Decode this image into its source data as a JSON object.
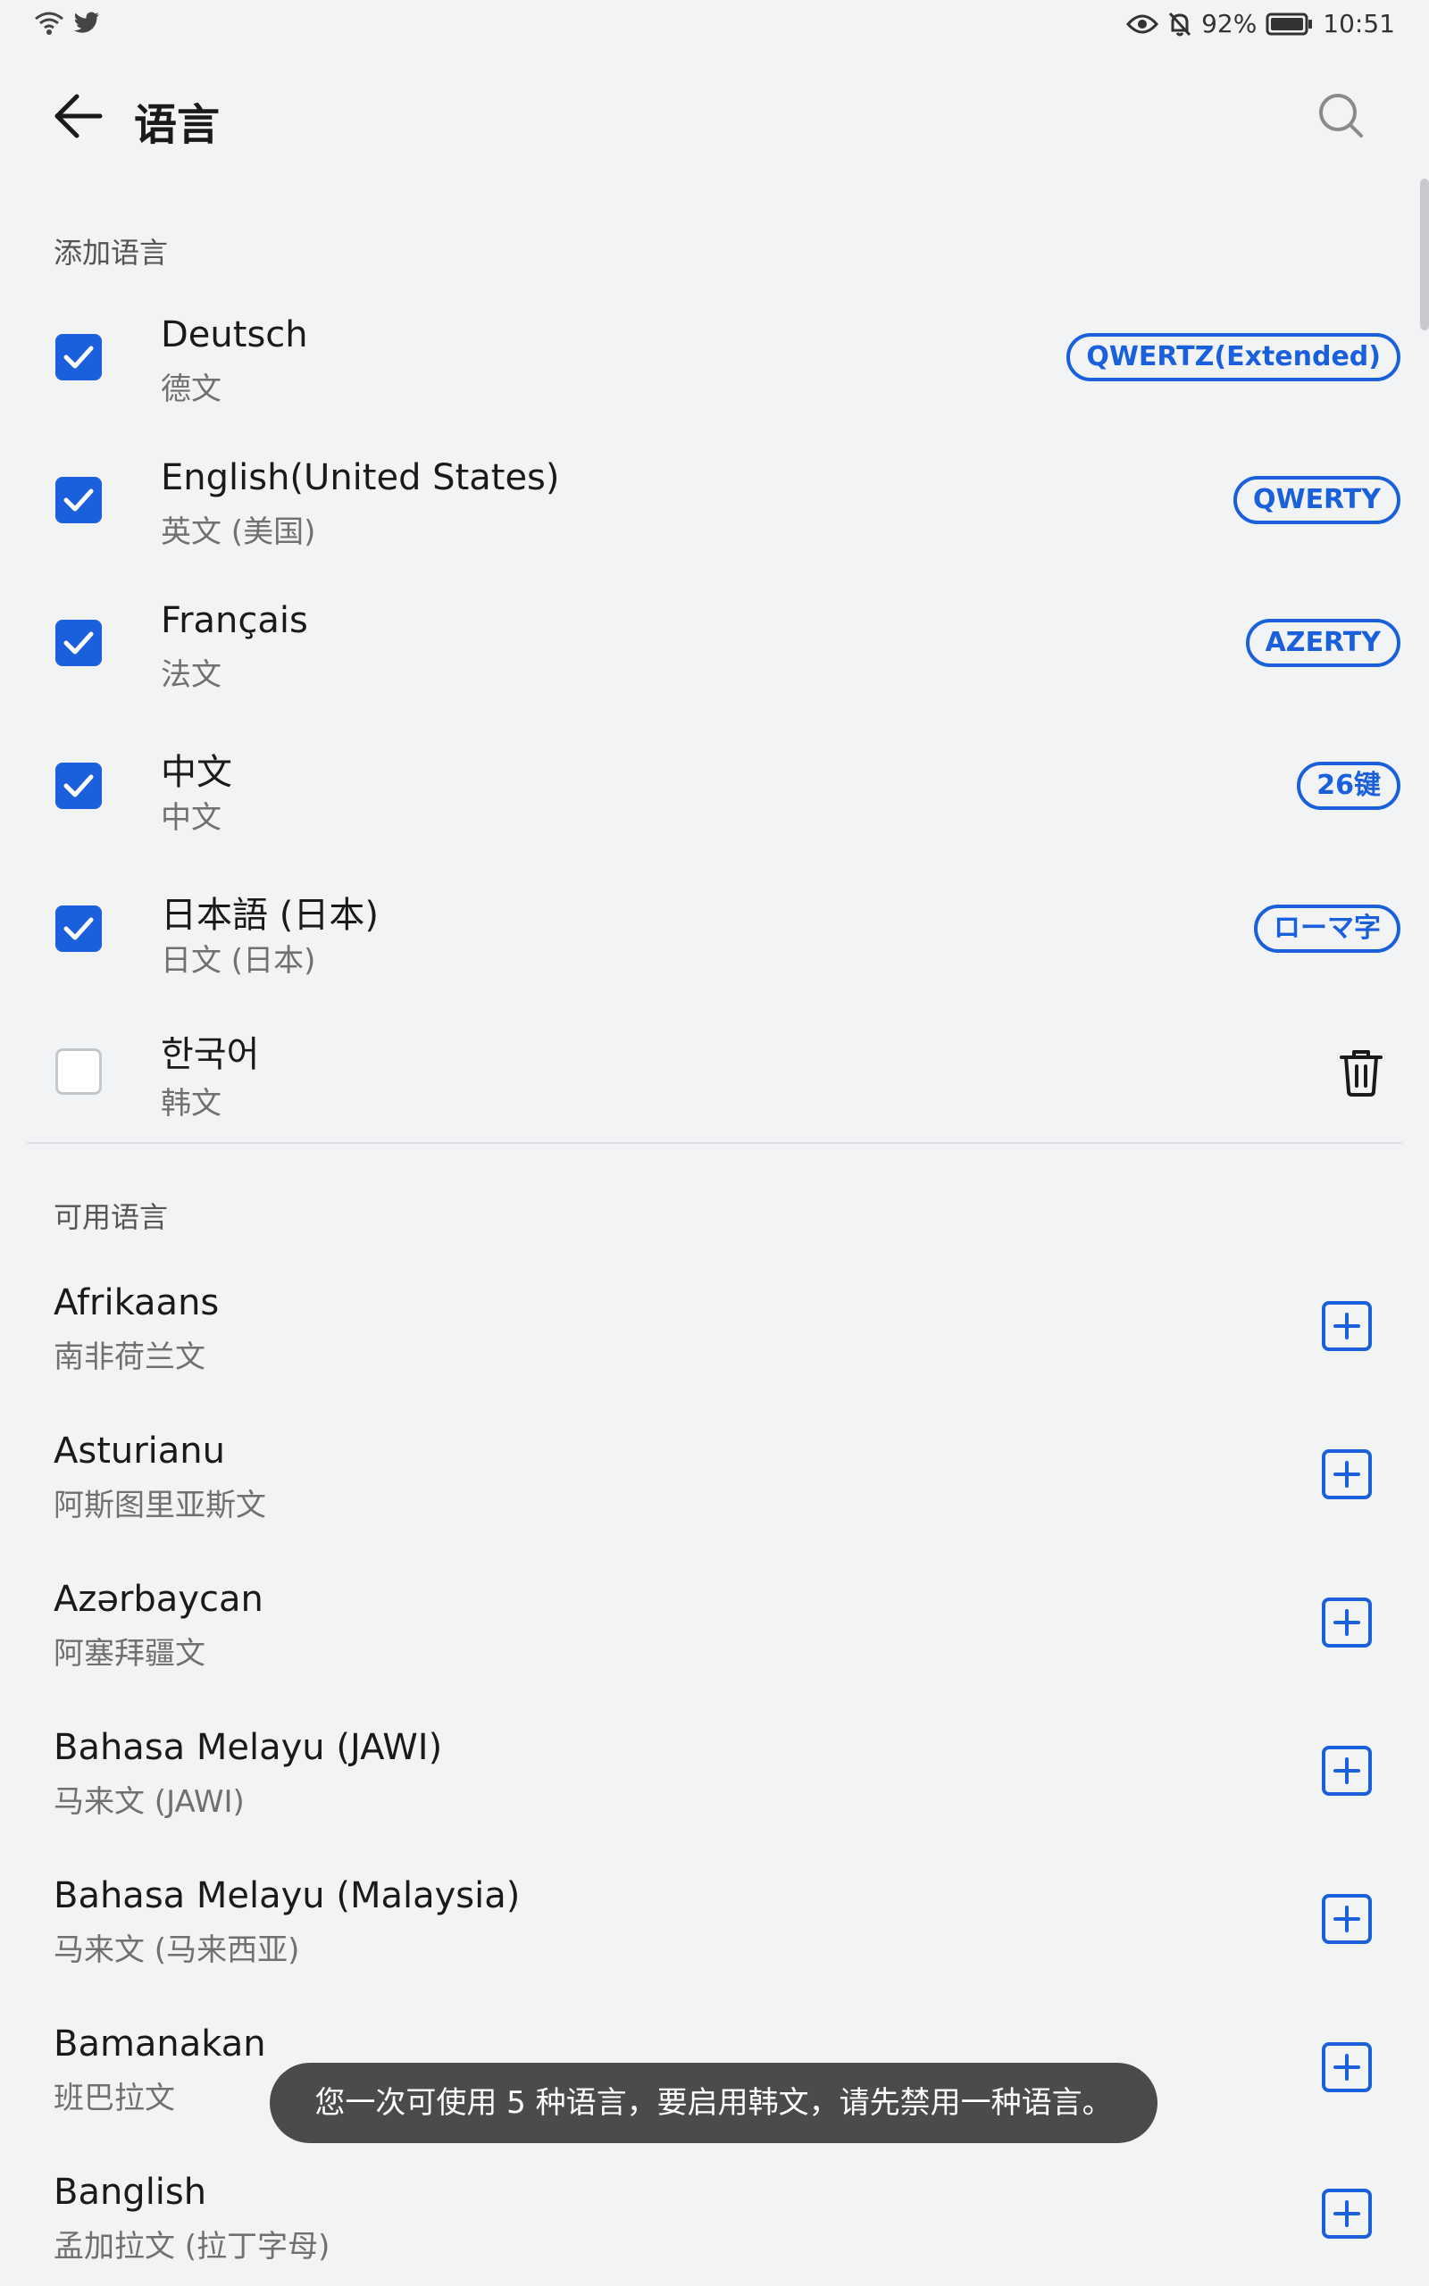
{
  "status_bar": {
    "battery": "92%",
    "time": "10:51"
  },
  "header": {
    "title": "语言"
  },
  "sections": {
    "added_title": "添加语言",
    "available_title": "可用语言"
  },
  "added_languages": [
    {
      "name": "Deutsch",
      "subtitle": "德文",
      "checked": true,
      "layout": "QWERTZ(Extended)"
    },
    {
      "name": "English(United States)",
      "subtitle": "英文 (美国)",
      "checked": true,
      "layout": "QWERTY"
    },
    {
      "name": "Français",
      "subtitle": "法文",
      "checked": true,
      "layout": "AZERTY"
    },
    {
      "name": "中文",
      "subtitle": "中文",
      "checked": true,
      "layout": "26键"
    },
    {
      "name": "日本語 (日本)",
      "subtitle": "日文 (日本)",
      "checked": true,
      "layout": "ローマ字"
    },
    {
      "name": "한국어",
      "subtitle": "韩文",
      "checked": false
    }
  ],
  "available_languages": [
    {
      "name": "Afrikaans",
      "subtitle": "南非荷兰文"
    },
    {
      "name": "Asturianu",
      "subtitle": "阿斯图里亚斯文"
    },
    {
      "name": "Azərbaycan",
      "subtitle": "阿塞拜疆文"
    },
    {
      "name": "Bahasa Melayu (JAWI)",
      "subtitle": "马来文 (JAWI)"
    },
    {
      "name": "Bahasa Melayu (Malaysia)",
      "subtitle": "马来文 (马来西亚)"
    },
    {
      "name": "Bamanakan",
      "subtitle": "班巴拉文"
    },
    {
      "name": "Banglish",
      "subtitle": "孟加拉文 (拉丁字母)"
    }
  ],
  "toast": {
    "message": "您一次可使用 5 种语言，要启用韩文，请先禁用一种语言。"
  },
  "colors": {
    "accent": "#1a5fdc",
    "background": "#f1f3f5",
    "toast_bg": "#4a4b4d"
  }
}
